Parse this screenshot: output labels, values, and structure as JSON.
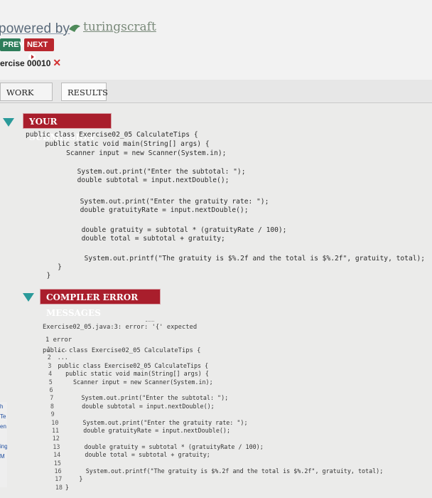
{
  "header": {
    "powered_by": "powered by",
    "brand": "turingscraft",
    "prev_label": "PREV",
    "next_label": "NEXT",
    "exercise_label": "ercise 00010"
  },
  "tabs": [
    {
      "label": "WORK AREA"
    },
    {
      "label": "RESULTS"
    }
  ],
  "submission": {
    "title": "YOUR SUBMISSION",
    "lines": [
      "public class Exercise02_05 CalculateTips {",
      "  public static void main(String[] args) {",
      "    Scanner input = new Scanner(System.in);",
      "",
      "      System.out.print(\"Enter the subtotal: \");",
      "      double subtotal = input.nextDouble();",
      "",
      "      System.out.print(\"Enter the gratuity rate: \");",
      "      double gratuityRate = input.nextDouble();",
      "",
      "      double gratuity = subtotal * (gratuityRate / 100);",
      "      double total = subtotal + gratuity;",
      "",
      "      System.out.printf(\"The gratuity is $%.2f and the total is $%.2f\", gratuity, total);",
      "    }",
      "  }"
    ]
  },
  "compiler": {
    "title": "COMPILER ERROR MESSAGES",
    "error_lines": [
      "Exercise02_05.java:3: error: '{' expected",
      "public class Exercise02_05 CalculateTips {"
    ],
    "error_count": "1 error",
    "listing": [
      {
        "n": "1",
        "text": "..."
      },
      {
        "n": "2",
        "text": "..."
      },
      {
        "n": "3",
        "text": "public class Exercise02_05 CalculateTips {"
      },
      {
        "n": "4",
        "text": "  public static void main(String[] args) {"
      },
      {
        "n": "5",
        "text": "    Scanner input = new Scanner(System.in);"
      },
      {
        "n": "6",
        "text": ""
      },
      {
        "n": "7",
        "text": "      System.out.print(\"Enter the subtotal: \");"
      },
      {
        "n": "8",
        "text": "      double subtotal = input.nextDouble();"
      },
      {
        "n": "9",
        "text": ""
      },
      {
        "n": "10",
        "text": "      System.out.print(\"Enter the gratuity rate: \");"
      },
      {
        "n": "11",
        "text": "      double gratuityRate = input.nextDouble();"
      },
      {
        "n": "12",
        "text": ""
      },
      {
        "n": "13",
        "text": "      double gratuity = subtotal * (gratuityRate / 100);"
      },
      {
        "n": "14",
        "text": "      double total = subtotal + gratuity;"
      },
      {
        "n": "15",
        "text": ""
      },
      {
        "n": "16",
        "text": "      System.out.printf(\"The gratuity is $%.2f and the total is $%.2f\", gratuity, total);"
      },
      {
        "n": "17",
        "text": "    }"
      },
      {
        "n": "18",
        "text": "}"
      }
    ]
  },
  "left_edge_fragments": [
    "h",
    "Te",
    "en",
    "ing",
    "M"
  ],
  "colors": {
    "accent_red": "#a91e2c",
    "teal_triangle": "#2a9a9a",
    "prev_green": "#2e7d5a",
    "next_red": "#b9272e"
  },
  "icons": {
    "brand_logo": "turingscraft-logo-icon",
    "next_arrow": "play-circle-icon",
    "exercise_status": "x-mark-icon",
    "collapse_toggle": "triangle-down-icon"
  }
}
